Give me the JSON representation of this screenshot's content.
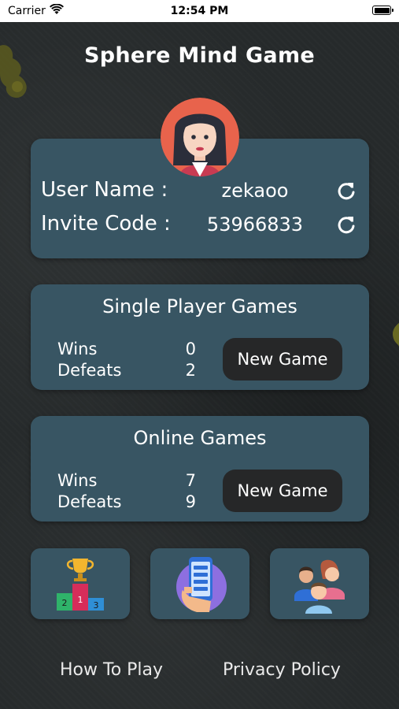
{
  "status_bar": {
    "carrier": "Carrier",
    "time": "12:54 PM"
  },
  "title": "Sphere Mind Game",
  "user": {
    "user_name_label": "User Name :",
    "user_name_value": "zekaoo",
    "invite_code_label": "Invite Code :",
    "invite_code_value": "53966833"
  },
  "single_player": {
    "title": "Single Player Games",
    "wins_label": "Wins",
    "wins_value": "0",
    "defeats_label": "Defeats",
    "defeats_value": "2",
    "new_game_label": "New Game"
  },
  "online": {
    "title": "Online Games",
    "wins_label": "Wins",
    "wins_value": "7",
    "defeats_label": "Defeats",
    "defeats_value": "9",
    "new_game_label": "New Game"
  },
  "tiles": [
    {
      "icon": "leaderboard-podium-icon",
      "podium": [
        "2",
        "1",
        "3"
      ]
    },
    {
      "icon": "phone-in-hand-icon"
    },
    {
      "icon": "friends-group-icon"
    }
  ],
  "footer": {
    "how_to_play": "How To Play",
    "privacy_policy": "Privacy Policy"
  },
  "colors": {
    "card": "#385563",
    "button": "#262728",
    "background": "#262a2b"
  }
}
